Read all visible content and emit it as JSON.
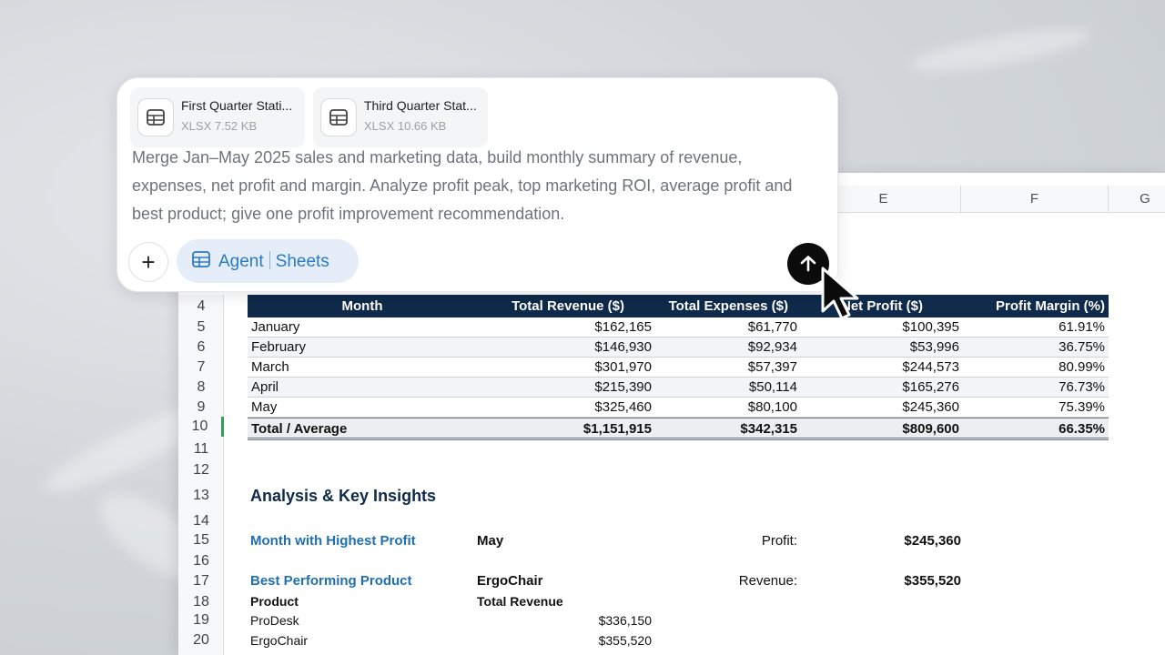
{
  "attachments": [
    {
      "name": "First Quarter Stati...",
      "meta": "XLSX 7.52 KB"
    },
    {
      "name": "Third Quarter Stat...",
      "meta": "XLSX 10.66 KB"
    }
  ],
  "prompt": "Merge Jan–May 2025 sales and marketing data, build monthly summary of revenue, expenses, net profit and margin. Analyze profit peak, top marketing ROI, average profit and best product; give one profit improvement recommendation.",
  "mode": {
    "agent": "Agent",
    "sheets": "Sheets"
  },
  "sheet": {
    "columns": [
      "E",
      "F",
      "G"
    ],
    "rows": [
      "4",
      "5",
      "6",
      "7",
      "8",
      "9",
      "10",
      "11",
      "12",
      "13",
      "14",
      "15",
      "16",
      "17",
      "18",
      "19",
      "20"
    ],
    "table_headers": [
      "Month",
      "Total Revenue ($)",
      "Total Expenses ($)",
      "Net Profit ($)",
      "Profit Margin (%)"
    ],
    "table_rows": [
      [
        "January",
        "$162,165",
        "$61,770",
        "$100,395",
        "61.91%"
      ],
      [
        "February",
        "$146,930",
        "$92,934",
        "$53,996",
        "36.75%"
      ],
      [
        "March",
        "$301,970",
        "$57,397",
        "$244,573",
        "80.99%"
      ],
      [
        "April",
        "$215,390",
        "$50,114",
        "$165,276",
        "76.73%"
      ],
      [
        "May",
        "$325,460",
        "$80,100",
        "$245,360",
        "75.39%"
      ]
    ],
    "total_row": [
      "Total / Average",
      "$1,151,915",
      "$342,315",
      "$809,600",
      "66.35%"
    ],
    "insights": {
      "title": "Analysis & Key Insights",
      "highest_label": "Month with Highest Profit",
      "highest_value": "May",
      "profit_label": "Profit:",
      "profit_value": "$245,360",
      "best_label": "Best Performing Product",
      "best_value": "ErgoChair",
      "revenue_label": "Revenue:",
      "revenue_value": "$355,520",
      "product_header": "Product",
      "total_rev_header": "Total Revenue",
      "products": [
        {
          "name": "ProDesk",
          "revenue": "$336,150"
        },
        {
          "name": "ErgoChair",
          "revenue": "$355,520"
        }
      ]
    }
  },
  "colors": {
    "header_navy": "#0f2a4a",
    "accent_blue": "#1f6fb3",
    "active_row": "#2e9e5b"
  }
}
